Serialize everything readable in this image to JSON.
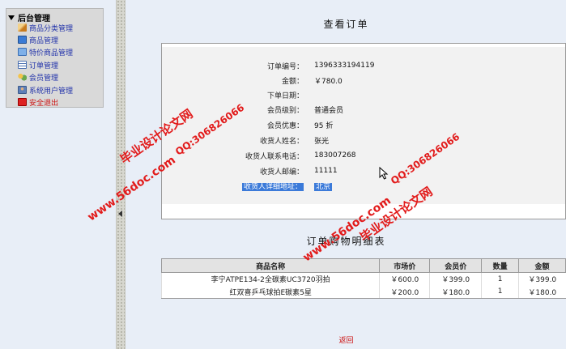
{
  "sidebar": {
    "header": "后台管理",
    "items": [
      {
        "label": "商品分类管理",
        "icon": "edit-icon",
        "color": "#c87b1e"
      },
      {
        "label": "商品管理",
        "icon": "products-icon",
        "color": "#3a7bd5"
      },
      {
        "label": "特价商品管理",
        "icon": "special-offer-icon",
        "color": "#3a7bd5"
      },
      {
        "label": "订单管理",
        "icon": "order-icon",
        "color": "#4a6fb0"
      },
      {
        "label": "会员管理",
        "icon": "members-icon",
        "color": "#6aa84f"
      },
      {
        "label": "系统用户管理",
        "icon": "system-user-icon",
        "color": "#5d7fb8"
      },
      {
        "label": "安全退出",
        "icon": "logout-icon",
        "color": "#d22"
      }
    ]
  },
  "order": {
    "title": "查看订单",
    "fields": [
      {
        "label": "订单编号：",
        "value": "1396333194119"
      },
      {
        "label": "金额：",
        "value": "￥780.0"
      },
      {
        "label": "下单日期：",
        "value": ""
      },
      {
        "label": "会员级别：",
        "value": "普通会员"
      },
      {
        "label": "会员优惠：",
        "value": "95 折"
      },
      {
        "label": "收货人姓名：",
        "value": "张光"
      },
      {
        "label": "收货人联系电话：",
        "value": "183007268"
      },
      {
        "label": "收货人邮编：",
        "value": "11111"
      },
      {
        "label": "收货人详细地址：",
        "value": "北京"
      }
    ]
  },
  "detail": {
    "title": "订单购物明细表",
    "columns": [
      "商品名称",
      "市场价",
      "会员价",
      "数量",
      "金额"
    ],
    "rows": [
      [
        "李宁ATPE134-2全碳素UC3720羽拍",
        "￥600.0",
        "￥399.0",
        "1",
        "￥399.0"
      ],
      [
        "红双喜乒乓球拍E碳素5星",
        "￥200.0",
        "￥180.0",
        "1",
        "￥180.0"
      ]
    ]
  },
  "back_label": "返回",
  "watermarks": {
    "site": "www.56doc.com",
    "qq": "QQ:306826066",
    "brand": "毕业设计论文网"
  },
  "colors": {
    "highlight": "#3b7ad9",
    "link": "#2233aa",
    "danger": "#cc1111",
    "watermark": "#e21b1b"
  }
}
